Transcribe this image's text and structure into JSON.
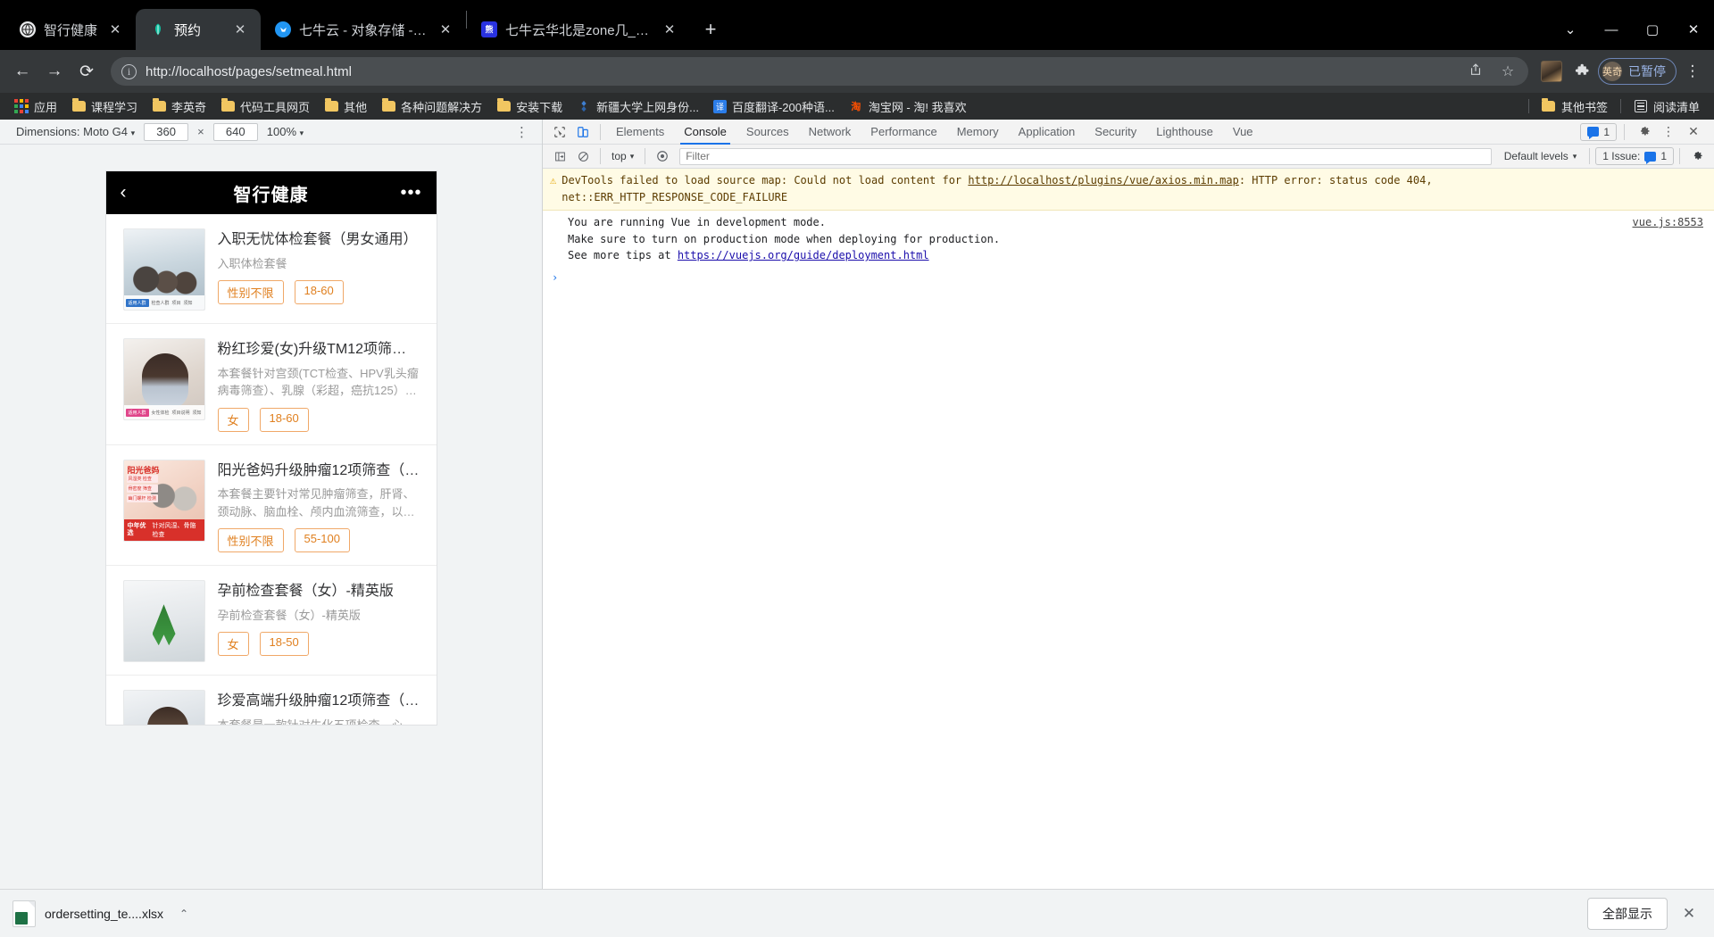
{
  "browser": {
    "tabs": [
      {
        "title": "智行健康",
        "favicon": "globe-icon",
        "active": false
      },
      {
        "title": "预约",
        "favicon": "leaf-icon",
        "active": true
      },
      {
        "title": "七牛云 - 对象存储 - 空间概览",
        "favicon": "qiniu-icon",
        "active": false
      },
      {
        "title": "七牛云华北是zone几_百度搜索",
        "favicon": "baidu-icon",
        "active": false
      }
    ],
    "close_label": "✕",
    "newtab_label": "+",
    "window_controls": {
      "minimize": "—",
      "maximize": "▢",
      "close": "✕",
      "expand": "⌄"
    },
    "nav": {
      "back": "←",
      "forward": "→",
      "reload": "⟳"
    },
    "omnibox": {
      "url": "http://localhost/pages/setmeal.html",
      "info_icon": "i",
      "share_icon": "share-icon",
      "star_icon": "☆"
    },
    "toolbar": {
      "avatar": "profile-photo",
      "extensions_icon": "puzzle-icon",
      "profile_initials": "英奇",
      "profile_status": "已暂停",
      "menu_icon": "⋮"
    },
    "bookmarks": [
      {
        "label": "应用",
        "icon": "apps-grid-icon"
      },
      {
        "label": "课程学习",
        "icon": "folder-icon"
      },
      {
        "label": "李英奇",
        "icon": "folder-icon"
      },
      {
        "label": "代码工具网页",
        "icon": "folder-icon"
      },
      {
        "label": "其他",
        "icon": "folder-icon"
      },
      {
        "label": "各种问题解决方",
        "icon": "folder-icon"
      },
      {
        "label": "安装下载",
        "icon": "folder-icon"
      },
      {
        "label": "新疆大学上网身份...",
        "icon": "site-icon"
      },
      {
        "label": "百度翻译-200种语...",
        "icon": "translate-icon"
      },
      {
        "label": "淘宝网 - 淘! 我喜欢",
        "icon": "taobao-icon"
      }
    ],
    "bookmarks_right": [
      {
        "label": "其他书签",
        "icon": "folder-icon"
      },
      {
        "label": "阅读清单",
        "icon": "reading-list-icon"
      }
    ]
  },
  "device_toolbar": {
    "dimensions_label": "Dimensions: Moto G4",
    "width": "360",
    "height": "640",
    "separator": "×",
    "zoom": "100%",
    "more_icon": "⋮"
  },
  "phone": {
    "header": {
      "back_icon": "‹",
      "title": "智行健康",
      "more_icon": "•••"
    },
    "items": [
      {
        "title": "入职无忧体检套餐（男女通用）",
        "desc": "入职体检套餐",
        "tags": [
          "性别不限",
          "18-60"
        ],
        "thumb": "office-team-photo",
        "thumb_caption_tags": [
          "适用人群",
          "检查项目",
          "注意事项",
          "预约须知"
        ]
      },
      {
        "title": "粉红珍爱(女)升级TM12项筛查体…",
        "desc": "本套餐针对宫颈(TCT检查、HPV乳头瘤病毒筛查）、乳腺（彩超，癌抗125）…",
        "tags": [
          "女",
          "18-60"
        ],
        "thumb": "young-woman-photo",
        "thumb_caption_tags": [
          "适用人群",
          "检查项目",
          "注意事项"
        ]
      },
      {
        "title": "阳光爸妈升级肿瘤12项筛查（男…",
        "desc": "本套餐主要针对常见肿瘤筛查，肝肾、颈动脉、脑血栓、颅内血流筛查，以及风…",
        "tags": [
          "性别不限",
          "55-100"
        ],
        "thumb": "elderly-couple-photo",
        "thumb_brand": "阳光爸妈",
        "thumb_badge_title": "中年优选",
        "thumb_badge_text": "针对风湿、骨骼检查"
      },
      {
        "title": "孕前检查套餐（女）-精英版",
        "desc": "孕前检查套餐（女）-精英版",
        "tags": [
          "女",
          "18-50"
        ],
        "thumb": "green-ribbon-hands-photo"
      },
      {
        "title": "珍爱高端升级肿瘤12项筛查（男…",
        "desc": "本套餐是一款针对生化五项检查，心…",
        "tags": [],
        "thumb": "doctor-photo"
      }
    ]
  },
  "devtools": {
    "tools": {
      "inspect_icon": "cursor-select-icon",
      "device_icon": "device-toggle-icon"
    },
    "tabs": [
      {
        "label": "Elements",
        "selected": false
      },
      {
        "label": "Console",
        "selected": true
      },
      {
        "label": "Sources",
        "selected": false
      },
      {
        "label": "Network",
        "selected": false
      },
      {
        "label": "Performance",
        "selected": false
      },
      {
        "label": "Memory",
        "selected": false
      },
      {
        "label": "Application",
        "selected": false
      },
      {
        "label": "Security",
        "selected": false
      },
      {
        "label": "Lighthouse",
        "selected": false
      },
      {
        "label": "Vue",
        "selected": false
      }
    ],
    "issue_count": "1",
    "settings_icon": "gear-icon",
    "more_icon": "⋮",
    "close_icon": "✕",
    "filterbar": {
      "sidebar_icon": "console-sidebar-icon",
      "clear_icon": "clear-console-icon",
      "context": "top",
      "eye_icon": "live-expression-icon",
      "filter_placeholder": "Filter",
      "levels": "Default levels",
      "issues_label": "1 Issue:",
      "issues_count": "1",
      "settings_icon": "gear-icon"
    },
    "messages": {
      "warning": {
        "icon": "warning-triangle-icon",
        "prefix": "DevTools failed to load source map: Could not load content for ",
        "link": "http://localhost/plugins/vue/axios.min.map",
        "suffix": ": HTTP error: status code 404,",
        "line2": "net::ERR_HTTP_RESPONSE_CODE_FAILURE"
      },
      "log": {
        "line1": "You are running Vue in development mode.",
        "line2": "Make sure to turn on production mode when deploying for production.",
        "line3_prefix": "See more tips at ",
        "line3_link": "https://vuejs.org/guide/deployment.html",
        "source": "vue.js:8553"
      },
      "prompt": "›"
    }
  },
  "downloads": {
    "file_name": "ordersetting_te....xlsx",
    "file_icon": "xlsx-file-icon",
    "caret_icon": "⌃",
    "show_all_label": "全部显示",
    "close_icon": "✕"
  },
  "colors": {
    "tab_active_bg": "#323639",
    "chrome_bg": "#000000",
    "navbar_bg": "#35383a",
    "accent_blue": "#1a73e8",
    "tag_orange": "#e08020",
    "warning_bg": "#fffbe5"
  }
}
